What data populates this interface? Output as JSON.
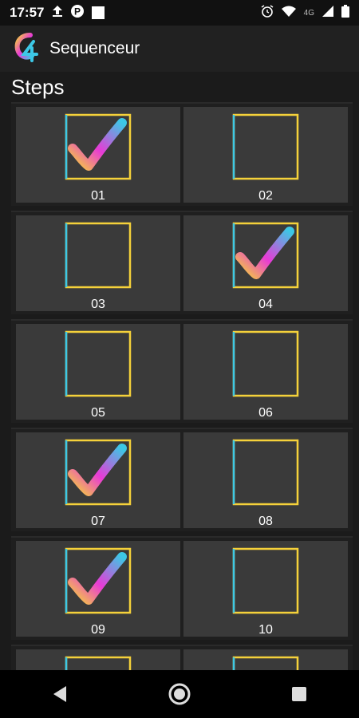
{
  "status_bar": {
    "time": "17:57",
    "left_icons": [
      "upload-icon",
      "parking-icon",
      "square-notification-icon"
    ],
    "right_icons": [
      "alarm-icon",
      "wifi-icon",
      "signal-icon",
      "battery-icon"
    ],
    "network": "4G"
  },
  "app_bar": {
    "title": "Sequenceur",
    "logo_icon": "app-logo-icon"
  },
  "section": {
    "title": "Steps"
  },
  "steps": [
    {
      "label": "01",
      "checked": true
    },
    {
      "label": "02",
      "checked": false
    },
    {
      "label": "03",
      "checked": false
    },
    {
      "label": "04",
      "checked": true
    },
    {
      "label": "05",
      "checked": false
    },
    {
      "label": "06",
      "checked": false
    },
    {
      "label": "07",
      "checked": true
    },
    {
      "label": "08",
      "checked": false
    },
    {
      "label": "09",
      "checked": true
    },
    {
      "label": "10",
      "checked": false
    },
    {
      "label": "",
      "checked": false
    },
    {
      "label": "",
      "checked": false
    }
  ],
  "nav_bar": {
    "buttons": [
      "back-icon",
      "home-icon",
      "recents-icon"
    ]
  },
  "colors": {
    "gradient_cyan": "#3cc8e6",
    "gradient_magenta": "#e83ad6",
    "gradient_yellow": "#f5d13a",
    "cell_bg": "#3a3a3a",
    "appbar_bg": "#212121"
  }
}
